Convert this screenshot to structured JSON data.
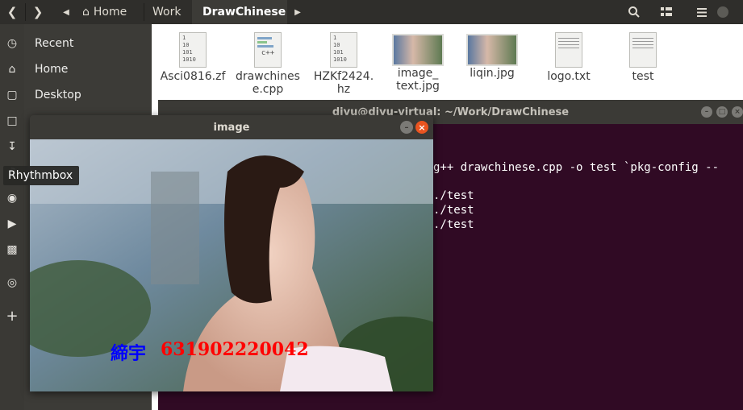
{
  "header": {
    "back_icon": "chevron-left-icon",
    "forward_icon": "chevron-right-icon",
    "crumb_left_icon": "triangle-left-icon",
    "crumb_right_icon": "triangle-right-icon",
    "breadcrumbs": [
      {
        "label": "Home",
        "icon": "home-icon"
      },
      {
        "label": "Work"
      },
      {
        "label": "DrawChinese"
      }
    ],
    "search_icon": "search-icon",
    "view_icon": "grid-view-icon",
    "menu_icon": "hamburger-menu-icon",
    "minimize_icon": "minimize-icon"
  },
  "dock": {
    "icons": [
      "clock-icon",
      "home-icon",
      "folder-icon",
      "document-icon",
      "download-icon",
      "music-icon",
      "camera-icon",
      "video-icon",
      "trash-icon",
      "disc-icon",
      "plus-icon"
    ]
  },
  "sidebar": {
    "items": [
      {
        "label": "Recent"
      },
      {
        "label": "Home"
      },
      {
        "label": "Desktop"
      }
    ]
  },
  "files": [
    {
      "name": "Asci0816.zf",
      "type": "binary"
    },
    {
      "name": "drawchinese.cpp",
      "name_line1": "drawchines",
      "name_line2": "e.cpp",
      "type": "cpp"
    },
    {
      "name": "HZKf2424.hz",
      "name_line1": "HZKf2424.",
      "name_line2": "hz",
      "type": "binary"
    },
    {
      "name": "image_text.jpg",
      "name_line1": "image_",
      "name_line2": "text.jpg",
      "type": "image"
    },
    {
      "name": "liqin.jpg",
      "type": "image"
    },
    {
      "name": "logo.txt",
      "type": "text"
    },
    {
      "name": "test",
      "type": "text"
    }
  ],
  "binary_icon_lines": [
    "1",
    "10",
    "101",
    "1010"
  ],
  "cpp_icon_label": "c++",
  "terminal": {
    "title": "divu@divu-virtual: ~/Work/DrawChinese",
    "lines": [
      "g++ drawchinese.cpp -o test `pkg-config --",
      "",
      "./test",
      "./test",
      "./test"
    ]
  },
  "image_window": {
    "title": "image",
    "overlay_chinese": "締宇",
    "overlay_number": "631902220042",
    "overlay_chinese_color": "#0000ff",
    "overlay_number_color": "#ff0000"
  },
  "tooltip": {
    "label": "Rhythmbox"
  }
}
